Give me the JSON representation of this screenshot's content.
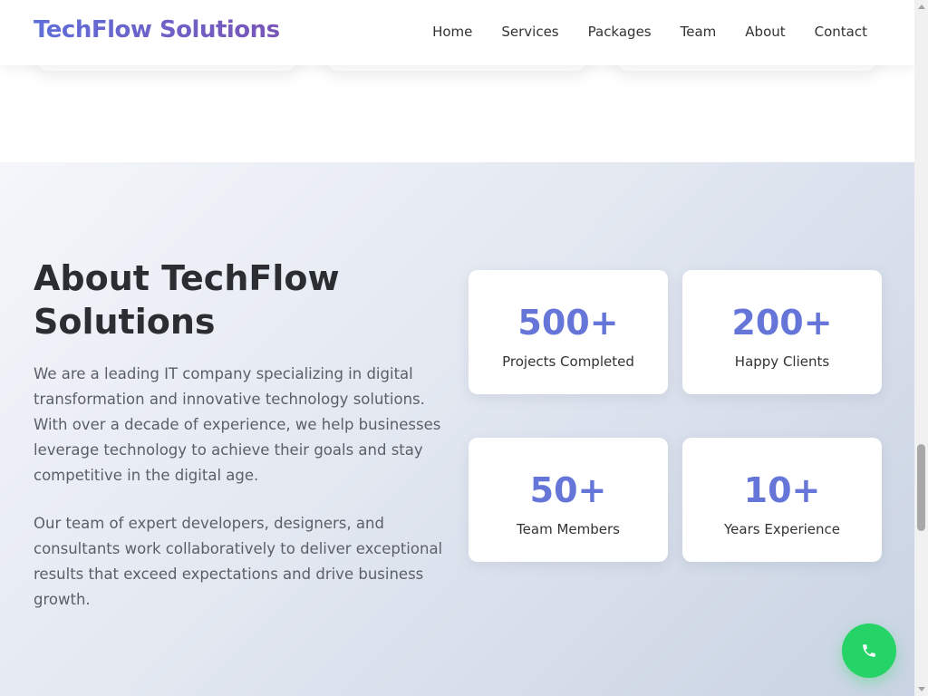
{
  "header": {
    "brand": "TechFlow Solutions",
    "nav": [
      "Home",
      "Services",
      "Packages",
      "Team",
      "About",
      "Contact"
    ]
  },
  "about": {
    "title": "About TechFlow Solutions",
    "paragraphs": [
      "We are a leading IT company specializing in digital transformation and innovative technology solutions. With over a decade of experience, we help businesses leverage technology to achieve their goals and stay competitive in the digital age.",
      "Our team of expert developers, designers, and consultants work collaboratively to deliver exceptional results that exceed expectations and drive business growth."
    ],
    "stats": [
      {
        "value": "500+",
        "label": "Projects Completed"
      },
      {
        "value": "200+",
        "label": "Happy Clients"
      },
      {
        "value": "50+",
        "label": "Team Members"
      },
      {
        "value": "10+",
        "label": "Years Experience"
      }
    ]
  },
  "floating_button": {
    "icon": "phone-icon",
    "color": "#25d366"
  },
  "colors": {
    "brand_start": "#5f6fd8",
    "brand_end": "#7a55b8",
    "stat_number": "#6576d8"
  }
}
